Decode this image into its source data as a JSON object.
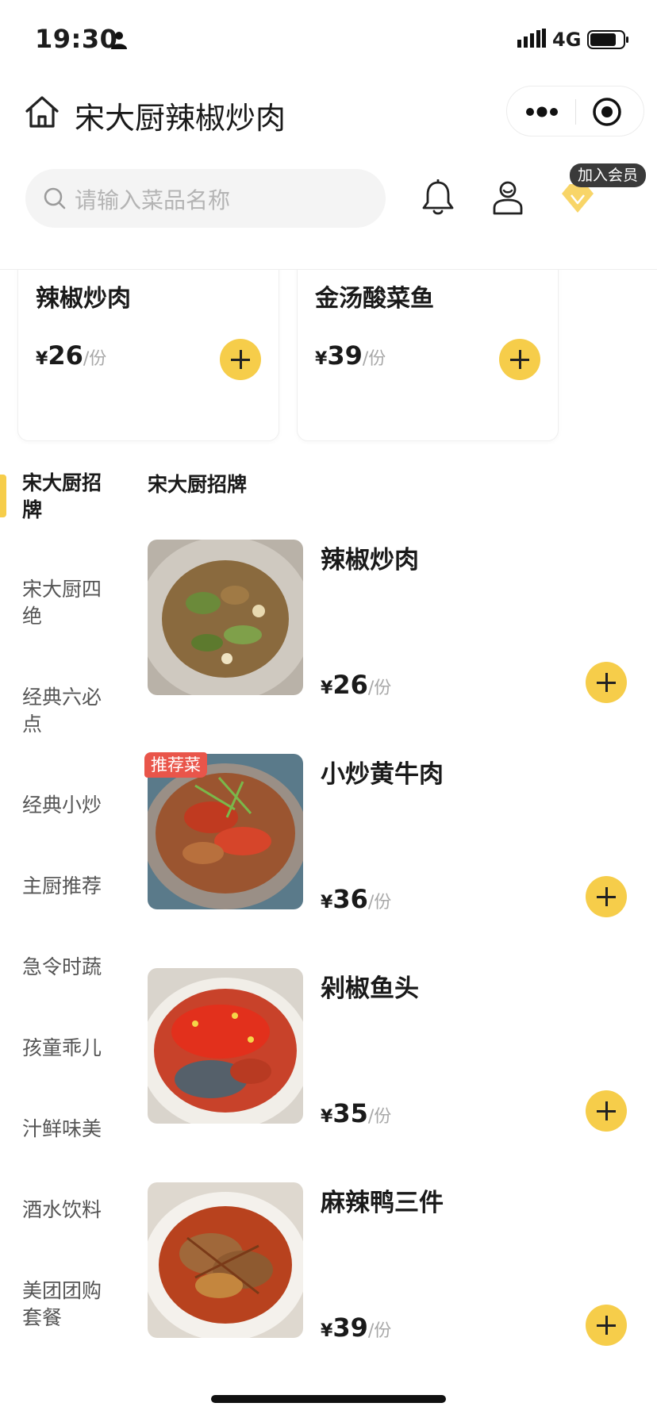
{
  "status_bar": {
    "time": "19:30",
    "network": "4G"
  },
  "header": {
    "title": "宋大厨辣椒炒肉"
  },
  "search": {
    "placeholder": "请输入菜品名称"
  },
  "member": {
    "badge": "加入会员"
  },
  "featured": [
    {
      "name": "辣椒炒肉",
      "currency": "¥",
      "price": "26",
      "unit": "/份"
    },
    {
      "name": "金汤酸菜鱼",
      "currency": "¥",
      "price": "39",
      "unit": "/份"
    }
  ],
  "categories": [
    "宋大厨招牌",
    "宋大厨四绝",
    "经典六必点",
    "经典小炒",
    "主厨推荐",
    "急令时蔬",
    "孩童乖儿",
    "汁鲜味美",
    "酒水饮料",
    "美团团购套餐"
  ],
  "section": {
    "title": "宋大厨招牌"
  },
  "dishes": [
    {
      "name": "辣椒炒肉",
      "currency": "¥",
      "price": "26",
      "unit": "/份",
      "tag": ""
    },
    {
      "name": "小炒黄牛肉",
      "currency": "¥",
      "price": "36",
      "unit": "/份",
      "tag": "推荐菜"
    },
    {
      "name": "剁椒鱼头",
      "currency": "¥",
      "price": "35",
      "unit": "/份",
      "tag": ""
    },
    {
      "name": "麻辣鸭三件",
      "currency": "¥",
      "price": "39",
      "unit": "/份",
      "tag": ""
    }
  ],
  "colors": {
    "accent": "#f6cd4a",
    "tag": "#e9554a",
    "placeholder": "#b4b4b4"
  }
}
